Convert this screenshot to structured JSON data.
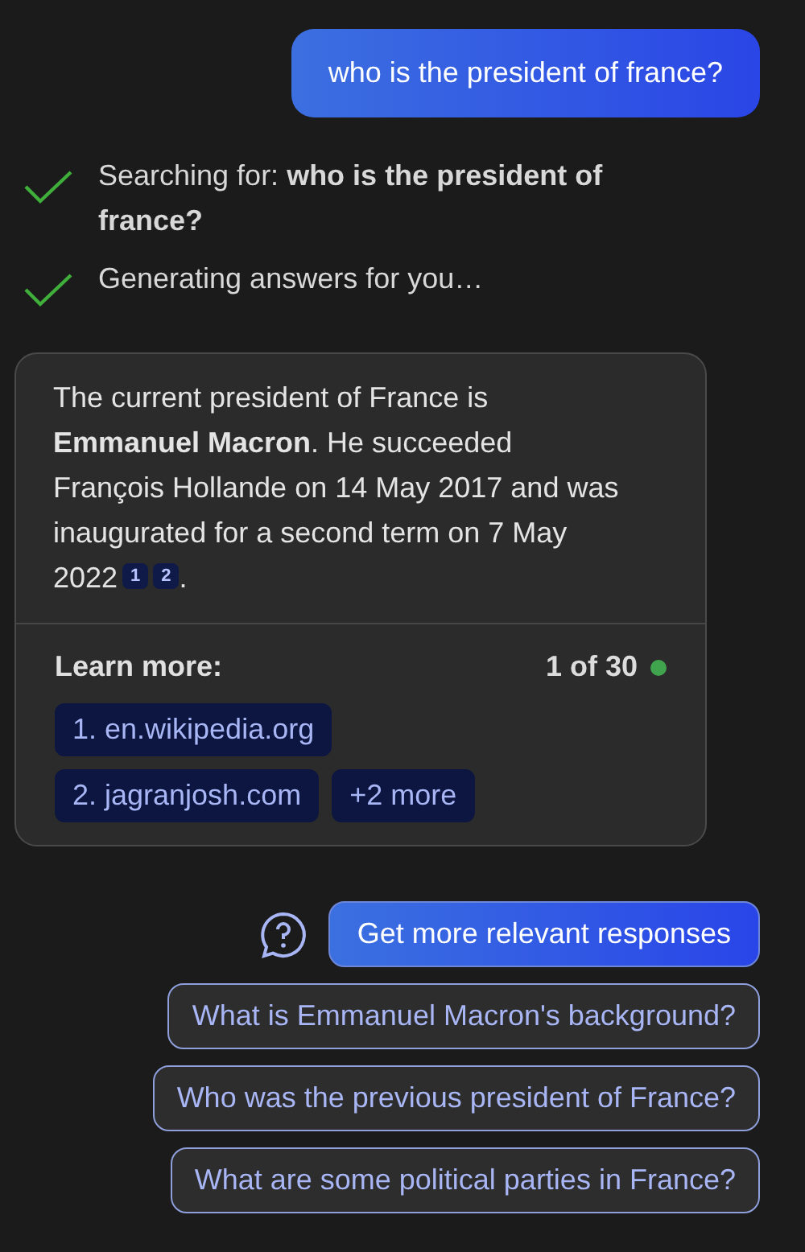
{
  "user_message": "who is the president of france?",
  "steps": [
    {
      "text": "Searching for: **who is the president of france?**",
      "done": true
    },
    {
      "text": "Generating answers for you…",
      "done": true
    }
  ],
  "answer": {
    "text": "The current president of France is **Emmanuel Macron**. He succeeded François Hollande on 14 May 2017 and was inaugurated for a second term on 7 May 2022",
    "citations": [
      "1",
      "2"
    ],
    "end": ".",
    "learn_more": "Learn more:",
    "counter": "1 of 30",
    "sources": [
      "1. en.wikipedia.org",
      "2. jagranjosh.com",
      "+2 more"
    ]
  },
  "primary_action": "Get more relevant responses",
  "suggestions": [
    "What is Emmanuel Macron's background?",
    "Who was the previous president of France?",
    "What are some political parties in France?"
  ]
}
